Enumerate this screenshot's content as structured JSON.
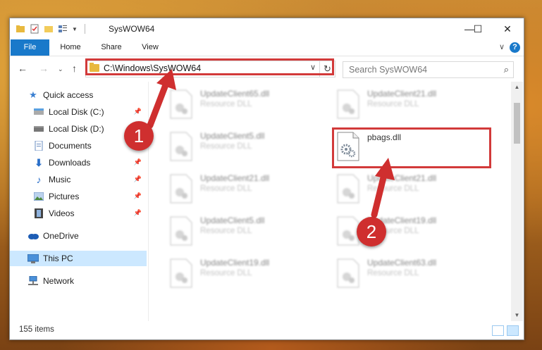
{
  "window": {
    "title": "SysWOW64",
    "controls": {
      "minimize": "—",
      "maximize": "☐",
      "close": "✕"
    }
  },
  "ribbon": {
    "tabs": [
      "File",
      "Home",
      "Share",
      "View"
    ],
    "help": "?"
  },
  "address_bar": {
    "path": "C:\\Windows\\SysWOW64"
  },
  "search": {
    "placeholder": "Search SysWOW64"
  },
  "sidebar": {
    "items": [
      {
        "label": "Quick access",
        "icon": "star-icon",
        "pinned": false
      },
      {
        "label": "Local Disk (C:)",
        "icon": "drive-icon",
        "pinned": true
      },
      {
        "label": "Local Disk (D:)",
        "icon": "drive-icon",
        "pinned": false
      },
      {
        "label": "Documents",
        "icon": "documents-icon",
        "pinned": false
      },
      {
        "label": "Downloads",
        "icon": "download-icon",
        "pinned": true
      },
      {
        "label": "Music",
        "icon": "music-icon",
        "pinned": true
      },
      {
        "label": "Pictures",
        "icon": "pictures-icon",
        "pinned": true
      },
      {
        "label": "Videos",
        "icon": "videos-icon",
        "pinned": true
      },
      {
        "label": "OneDrive",
        "icon": "cloud-icon",
        "pinned": false
      },
      {
        "label": "This PC",
        "icon": "computer-icon",
        "pinned": false,
        "selected": true
      },
      {
        "label": "Network",
        "icon": "network-icon",
        "pinned": false
      }
    ]
  },
  "files": [
    {
      "name": "UpdateClient65.dll",
      "type": "Resource DLL",
      "blurred": true
    },
    {
      "name": "UpdateClient21.dll",
      "type": "Resource DLL",
      "blurred": true
    },
    {
      "name": "UpdateClient5.dll",
      "type": "Resource DLL",
      "blurred": true
    },
    {
      "name": "pbags.dll",
      "type": "",
      "blurred": false
    },
    {
      "name": "UpdateClient21.dll",
      "type": "Resource DLL",
      "blurred": true
    },
    {
      "name": "UpdateClient21.dll",
      "type": "Resource DLL",
      "blurred": true
    },
    {
      "name": "UpdateClient5.dll",
      "type": "Resource DLL",
      "blurred": true
    },
    {
      "name": "UpdateClient19.dll",
      "type": "Resource DLL",
      "blurred": true
    },
    {
      "name": "UpdateClient19.dll",
      "type": "Resource DLL",
      "blurred": true
    },
    {
      "name": "UpdateClient63.dll",
      "type": "Resource DLL",
      "blurred": true
    }
  ],
  "status": {
    "item_count": "155 items"
  },
  "annotations": {
    "step1": "1",
    "step2": "2",
    "highlight_color": "#d23a3a"
  },
  "colors": {
    "accent": "#1979ca",
    "selection": "#cce8ff"
  }
}
